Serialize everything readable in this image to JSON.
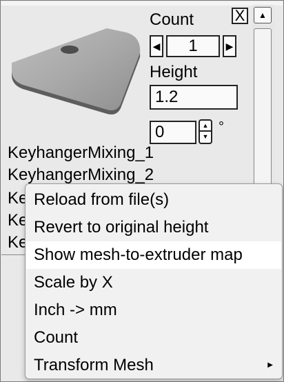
{
  "panel": {
    "close_label": "X",
    "scroll_up_glyph": "▲"
  },
  "count": {
    "label": "Count",
    "value": "1",
    "dec_glyph": "◀",
    "inc_glyph": "▶"
  },
  "height": {
    "label": "Height",
    "value": "1.2"
  },
  "rotation": {
    "value": "0",
    "unit": "°",
    "up_glyph": "▲",
    "down_glyph": "▼"
  },
  "mesh_list": [
    "KeyhangerMixing_1",
    "KeyhangerMixing_2",
    "Ke",
    "Ke",
    "Ke"
  ],
  "context_menu": {
    "items": [
      "Reload from file(s)",
      "Revert to original height",
      "Show mesh-to-extruder map",
      "Scale by X",
      "Inch -> mm",
      "Count",
      "Transform Mesh"
    ],
    "highlighted_index": 2,
    "submenu_arrow": "▶"
  },
  "colors": {
    "panel_bg": "#e9e9e9",
    "highlight_bg": "#ffffff"
  }
}
